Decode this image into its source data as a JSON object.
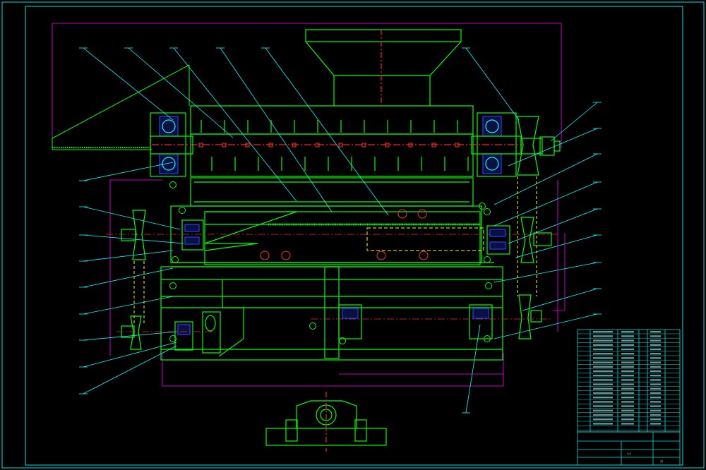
{
  "colors": {
    "background": "#000000",
    "frame": "#00e0e0",
    "body": "#00ff00",
    "cyan": "#00ffff",
    "centerline": "#ff2020",
    "dimension": "#ff00ff",
    "hidden": "#ffff00",
    "bolt": "#ff3030",
    "leader": "#ffffff"
  },
  "titleblock": {
    "scale_label": "1:?",
    "drawing_no": "??"
  }
}
